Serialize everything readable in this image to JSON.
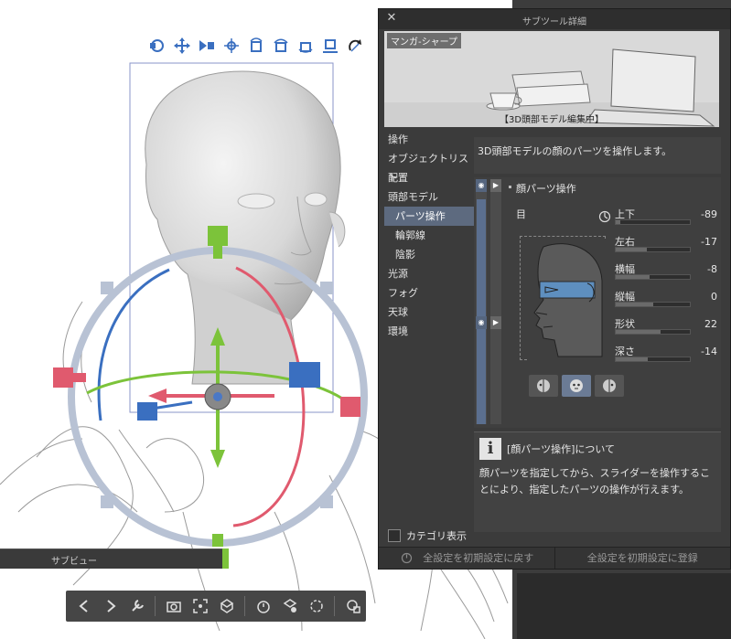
{
  "gizmo_toolbar": {
    "icons": [
      "move-camera-icon",
      "pan-camera-icon",
      "zoom-camera-icon",
      "move-object-icon",
      "rotate-object-icon",
      "rotate-object-x-icon",
      "rotate-object-y-icon",
      "ground-snap-icon",
      "undo-rotate-icon"
    ]
  },
  "subview": {
    "label": "サブビュー"
  },
  "bottom_toolbar": {
    "icons": [
      "prev-icon",
      "next-icon",
      "wrench-icon",
      "camera-icon",
      "fit-icon",
      "ground-icon",
      "timer-icon",
      "object-move-icon",
      "rotate-reset-icon",
      "head-model-icon"
    ]
  },
  "panel": {
    "title": "サブツール詳細",
    "preview_tag": "マンガ-シャープ",
    "preview_caption": "【3D頭部モデル編集中】",
    "categories": [
      {
        "label": "操作",
        "sub": false,
        "active": false
      },
      {
        "label": "オブジェクトリスト",
        "sub": false,
        "active": false
      },
      {
        "label": "配置",
        "sub": false,
        "active": false
      },
      {
        "label": "頭部モデル",
        "sub": false,
        "active": false
      },
      {
        "label": "パーツ操作",
        "sub": true,
        "active": true
      },
      {
        "label": "輪郭線",
        "sub": true,
        "active": false
      },
      {
        "label": "陰影",
        "sub": true,
        "active": false
      },
      {
        "label": "光源",
        "sub": false,
        "active": false
      },
      {
        "label": "フォグ",
        "sub": false,
        "active": false
      },
      {
        "label": "天球",
        "sub": false,
        "active": false
      },
      {
        "label": "環境",
        "sub": false,
        "active": false
      }
    ],
    "description": "3D頭部モデルの顔のパーツを操作します。",
    "section_title": "顔パーツ操作",
    "target_label": "目",
    "params": [
      {
        "label": "上下",
        "value": "-89",
        "fill": 0.06
      },
      {
        "label": "左右",
        "value": "-17",
        "fill": 0.42
      },
      {
        "label": "横幅",
        "value": "-8",
        "fill": 0.46
      },
      {
        "label": "縦幅",
        "value": "0",
        "fill": 0.5
      },
      {
        "label": "形状",
        "value": "22",
        "fill": 0.61
      },
      {
        "label": "深さ",
        "value": "-14",
        "fill": 0.43
      }
    ],
    "view_buttons": [
      "face-left-icon",
      "face-front-icon",
      "face-right-icon"
    ],
    "info_title": "[顔パーツ操作]について",
    "info_body": "顔パーツを指定してから、スライダーを操作することにより、指定したパーツの操作が行えます。",
    "category_toggle": "カテゴリ表示",
    "footer": {
      "reset": "全設定を初期設定に戻す",
      "register": "全設定を初期設定に登録"
    }
  },
  "colors": {
    "panel_bg": "#3b3b3b",
    "accent": "#5d6a7f",
    "gizmo_red": "#e05a6e",
    "gizmo_green": "#7cc33a",
    "gizmo_blue": "#3a6fc0",
    "gizmo_ring": "#b8c2d4"
  }
}
